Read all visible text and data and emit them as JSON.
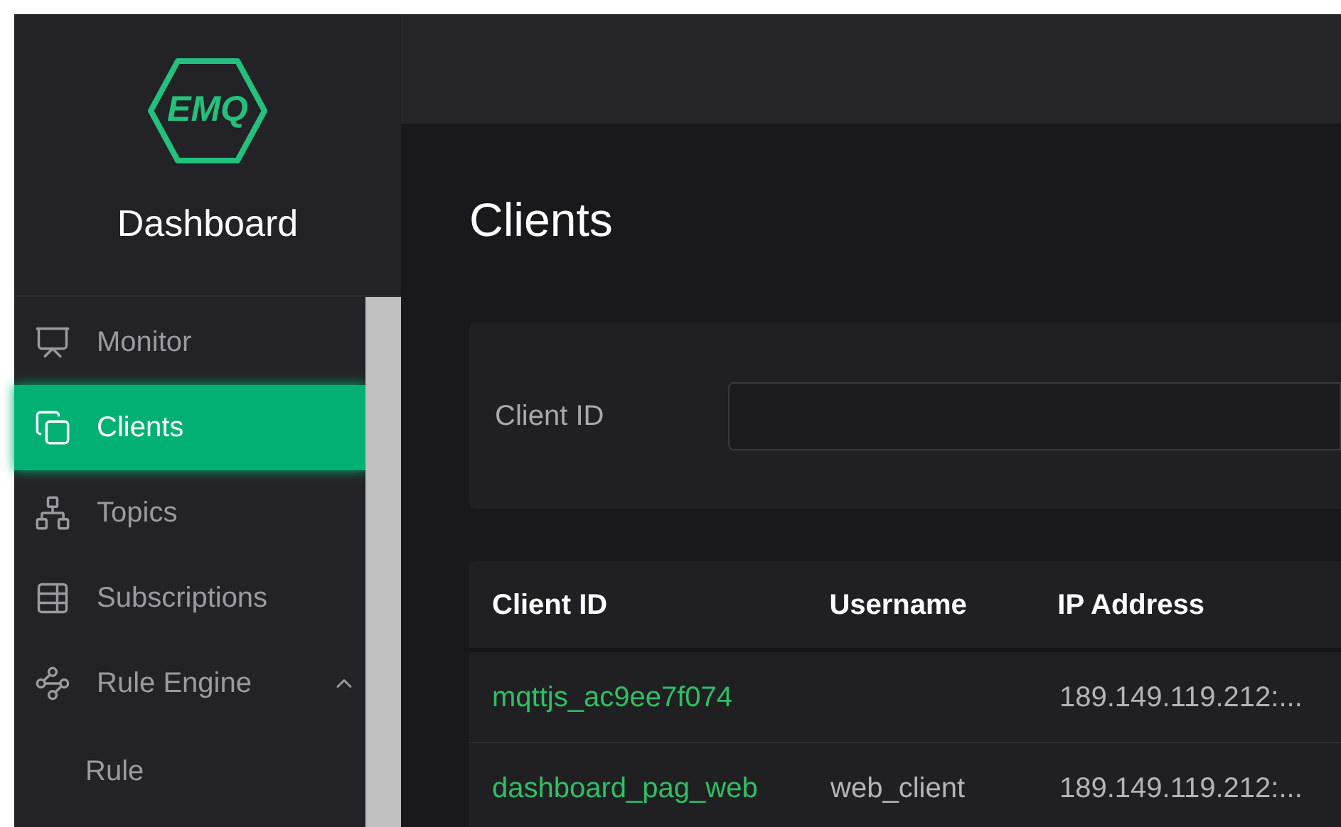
{
  "logo": {
    "text": "EMQ",
    "title": "Dashboard"
  },
  "sidebar": {
    "items": [
      {
        "kind": "item",
        "label": "Monitor",
        "selected": false
      },
      {
        "kind": "item",
        "label": "Clients",
        "selected": true
      },
      {
        "kind": "item",
        "label": "Topics",
        "selected": false
      },
      {
        "kind": "item",
        "label": "Subscriptions",
        "selected": false
      },
      {
        "kind": "group",
        "label": "Rule Engine",
        "expanded": true,
        "children": [
          {
            "kind": "subitem",
            "label": "Rule",
            "selected": false
          }
        ]
      }
    ]
  },
  "page": {
    "title": "Clients"
  },
  "search": {
    "label": "Client ID"
  },
  "table": {
    "columns": [
      "Client ID",
      "Username",
      "IP Address"
    ],
    "rows": [
      {
        "client_id": "mqttjs_ac9ee7f074",
        "ip": "189.149.119.212:..."
      },
      {
        "client_id": "dashboard_pag_web",
        "username": "web_client",
        "ip": "189.149.119.212:..."
      }
    ]
  }
}
